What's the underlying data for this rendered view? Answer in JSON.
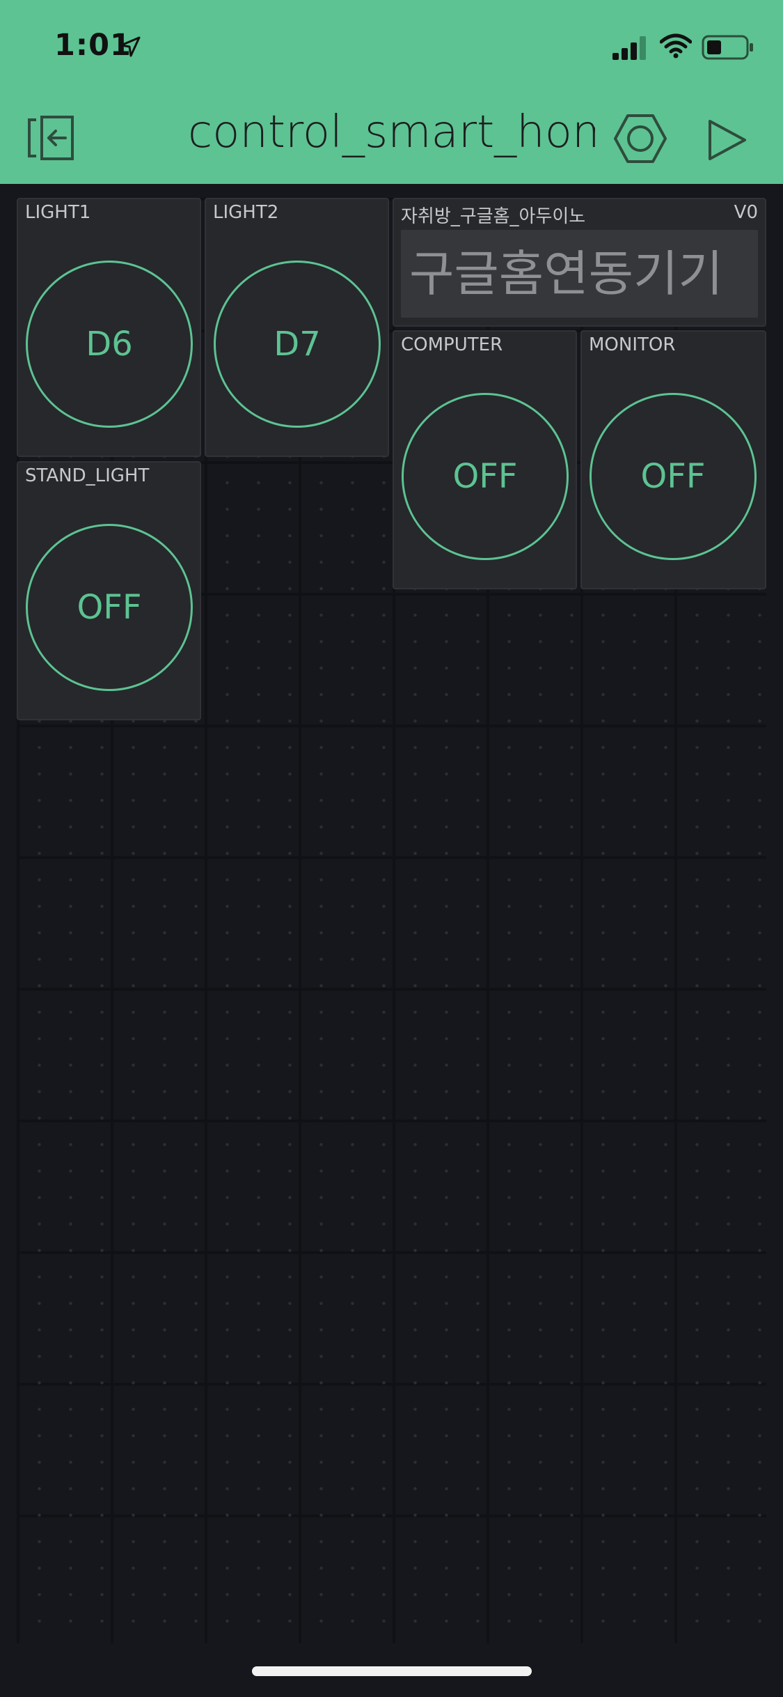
{
  "status_bar": {
    "time": "1:01"
  },
  "header": {
    "title": "control_smart_home"
  },
  "widgets": {
    "light1": {
      "label": "LIGHT1",
      "button": "D6"
    },
    "light2": {
      "label": "LIGHT2",
      "button": "D7"
    },
    "text_input": {
      "label": "자취방_구글홈_아두이노",
      "pin": "V0",
      "value": "구글홈연동기기"
    },
    "computer": {
      "label": "COMPUTER",
      "button": "OFF"
    },
    "monitor": {
      "label": "MONITOR",
      "button": "OFF"
    },
    "stand_light": {
      "label": "STAND_LIGHT",
      "button": "OFF"
    }
  },
  "colors": {
    "accent": "#5dc392",
    "background": "#15171c",
    "widget": "#26282c"
  }
}
